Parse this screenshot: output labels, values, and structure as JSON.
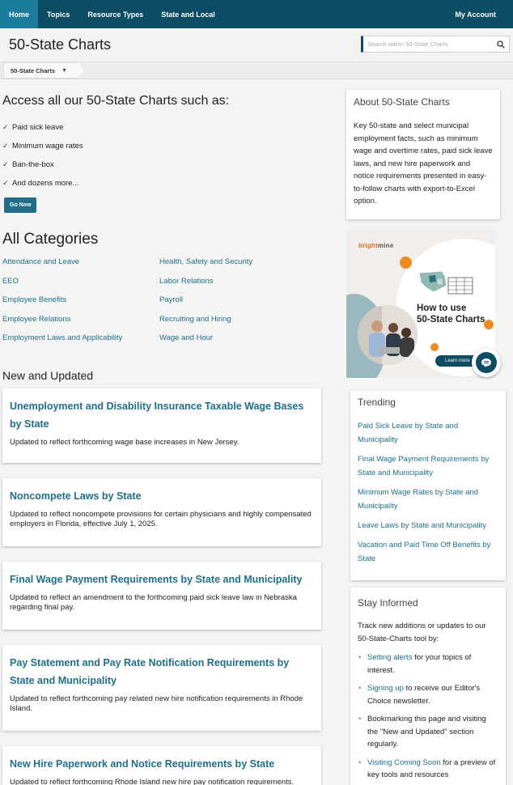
{
  "nav": {
    "items": [
      "Home",
      "Topics",
      "Resource Types",
      "State and Local"
    ],
    "account": "My Account"
  },
  "header": {
    "title": "50-State Charts",
    "search_placeholder": "Search within 50-State Charts"
  },
  "breadcrumb": {
    "label": "50-State Charts"
  },
  "access": {
    "title": "Access all our 50-State Charts such as:",
    "items": [
      "Paid sick leave",
      "Minimum wage rates",
      "Ban-the-box",
      "And dozens more..."
    ],
    "button": "Go Now"
  },
  "categories": {
    "title": "All Categories",
    "left": [
      "Attendance and Leave",
      "EEO",
      "Employee Benefits",
      "Employee Relations",
      "Employment Laws and Applicability"
    ],
    "right": [
      "Health, Safety and Security",
      "Labor Relations",
      "Payroll",
      "Recruiting and Hiring",
      "Wage and Hour"
    ]
  },
  "new_updated": {
    "title": "New and Updated",
    "cards": [
      {
        "title": "Unemployment and Disability Insurance Taxable Wage Bases by State",
        "desc": "Updated to reflect forthcoming wage base increases in New Jersey."
      },
      {
        "title": "Noncompete Laws by State",
        "desc": "Updated to reflect noncompete provisions for certain physicians and highly compensated employers in Florida, effective July 1, 2025."
      },
      {
        "title": "Final Wage Payment Requirements by State and Municipality",
        "desc": "Updated to reflect an amendment to the forthcoming paid sick leave law in Nebraska regarding final pay."
      },
      {
        "title": "Pay Statement and Pay Rate Notification Requirements by State and Municipality",
        "desc": "Updated to reflect forthcoming pay related new hire notification requirements in Rhode Island."
      },
      {
        "title": "New Hire Paperwork and Notice Requirements by State",
        "desc": "Updated to reflect forthcoming Rhode Island new hire pay notification requirements."
      }
    ]
  },
  "about": {
    "title": "About 50-State Charts",
    "body": "Key 50-state and select municipal employment facts, such as minimum wage and overtime rates, paid sick leave laws, and new hire paperwork and notice requirements presented in easy-to-follow charts with export-to-Excel option."
  },
  "promo": {
    "brand_a": "bright",
    "brand_b": "mine",
    "line1": "How to use",
    "line2": "50-State Charts",
    "button": "Learn more"
  },
  "trending": {
    "title": "Trending",
    "links": [
      "Paid Sick Leave by State and Municipality",
      "Final Wage Payment Requirements by State and Municipality",
      "Minimum Wage Rates by State and Municipality",
      "Leave Laws by State and Municipality",
      "Vacation and Paid Time Off Benefits by State"
    ]
  },
  "stay": {
    "title": "Stay Informed",
    "intro": "Track new additions or updates to our 50-State-Charts tool by:",
    "b1_link": "Setting alerts",
    "b1_text": " for your topics of interest.",
    "b2_link": "Signing up",
    "b2_text": " to receive our Editor's Choice newsletter.",
    "b3_text": "Bookmarking this page and visiting the \"New and Updated\" section regularly.",
    "b4_link": "Visiting Coming Soon",
    "b4_text": " for a preview of key tools and resources"
  },
  "colors": {
    "nav": "#0d4d63",
    "nav_active": "#1b7d9b",
    "link": "#1f6f8b",
    "accent": "#f08a1e"
  }
}
